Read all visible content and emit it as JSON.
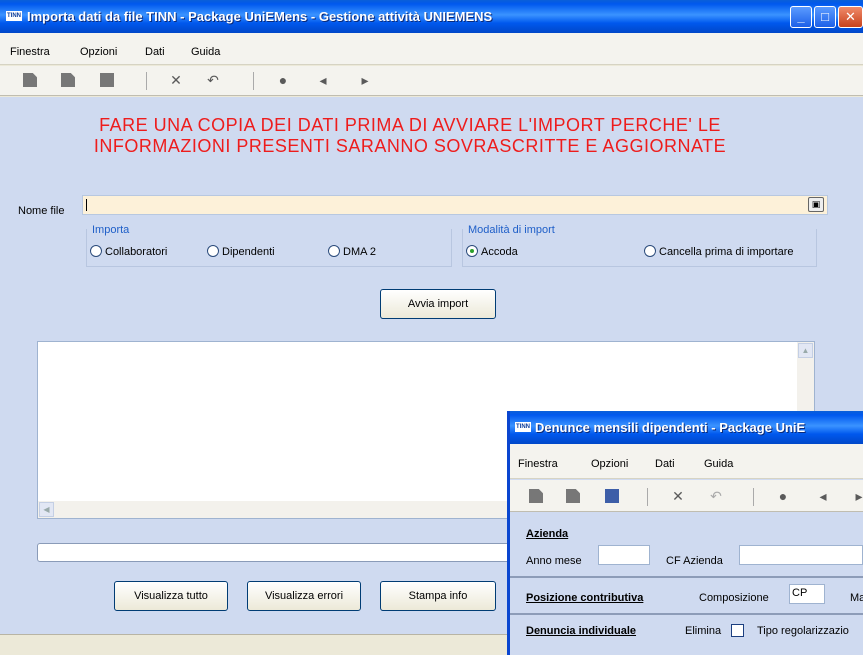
{
  "main_window": {
    "title": "Importa dati da file TINN - Package UniEMens - Gestione attività UNIEMENS",
    "app_icon_text": "TINN",
    "menu": [
      "Finestra",
      "Opzioni",
      "Dati",
      "Guida"
    ],
    "toolbar_icons": [
      "new-icon",
      "save-icon",
      "stop-icon",
      "delete-icon",
      "undo-icon",
      "search-icon",
      "back-icon",
      "forward-icon"
    ],
    "warning": "FARE UNA COPIA DEI DATI PRIMA DI AVVIARE L'IMPORT PERCHE' LE INFORMAZIONI PRESENTI SARANNO SOVRASCRITTE E AGGIORNATE",
    "nome_file_label": "Nome file",
    "nome_file_value": "",
    "importa_label": "Importa",
    "importa_options": [
      "Collaboratori",
      "Dipendenti",
      "DMA 2"
    ],
    "modalita_label": "Modalità di import",
    "modalita_options": [
      "Accoda",
      "Cancella prima di importare"
    ],
    "modalita_selected": "Accoda",
    "avvia_button": "Avvia import",
    "buttons": {
      "visualizza_tutto": "Visualizza tutto",
      "visualizza_errori": "Visualizza errori",
      "stampa_info": "Stampa info"
    }
  },
  "second_window": {
    "title": "Denunce mensili dipendenti - Package UniE",
    "menu": [
      "Finestra",
      "Opzioni",
      "Dati",
      "Guida"
    ],
    "azienda_label": "Azienda",
    "anno_mese_label": "Anno mese",
    "cf_azienda_label": "CF Azienda",
    "posizione_label": "Posizione contributiva",
    "composizione_label": "Composizione",
    "composizione_value": "CP",
    "extra_label": "Ma",
    "denuncia_label": "Denuncia individuale",
    "elimina_label": "Elimina",
    "tipo_label": "Tipo regolarizzazio"
  },
  "colors": {
    "title_bar": "#0058ee",
    "client_bg": "#cfdaf0",
    "warning_text": "#ee1c1c",
    "group_title": "#1f5fc8",
    "file_input_bg": "#fdf1d9"
  }
}
